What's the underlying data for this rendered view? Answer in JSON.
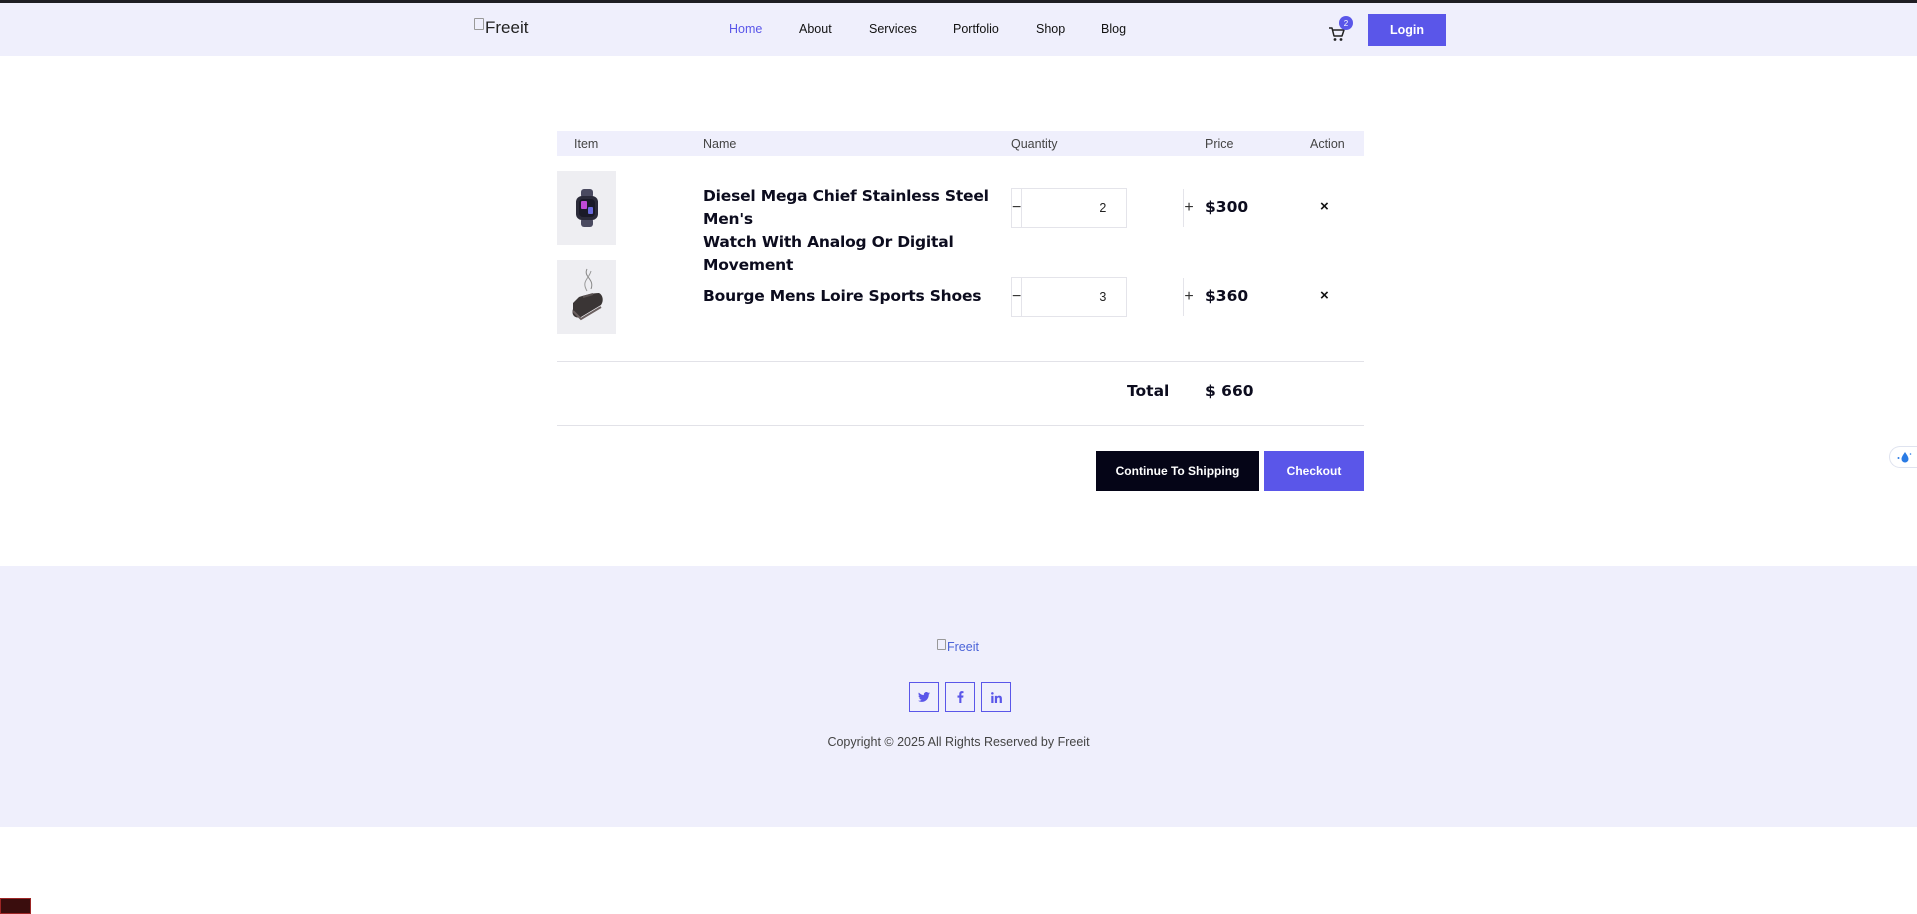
{
  "header": {
    "logo_alt": "Freeit",
    "nav": [
      "Home",
      "About",
      "Services",
      "Portfolio",
      "Shop",
      "Blog"
    ],
    "active_nav": "Home",
    "cart_icon": "cart-icon",
    "cart_count": "2",
    "login_label": "Login"
  },
  "cart": {
    "columns": {
      "item": "Item",
      "name": "Name",
      "quantity": "Quantity",
      "price": "Price",
      "action": "Action"
    },
    "items": [
      {
        "name_line1": "Diesel Mega Chief Stainless Steel Men's",
        "name_line2": "Watch With Analog Or Digital Movement",
        "quantity": "2",
        "price": "$300",
        "image_icon": "smartwatch-image"
      },
      {
        "name_line1": "Bourge Mens Loire Sports Shoes",
        "name_line2": "",
        "quantity": "3",
        "price": "$360",
        "image_icon": "shoe-image"
      }
    ],
    "remove_symbol": "×",
    "minus_symbol": "−",
    "plus_symbol": "+",
    "total_label": "Total",
    "total_value": "$ 660",
    "continue_label": "Continue To Shipping",
    "checkout_label": "Checkout"
  },
  "footer": {
    "logo_alt": "Freeit",
    "socials": [
      "twitter-icon",
      "facebook-icon",
      "linkedin-icon"
    ],
    "copyright": "Copyright © 2025 All Rights Reserved by Freeit"
  },
  "colors": {
    "accent": "#5a56e9",
    "header_bg": "#efeffc",
    "dark_button": "#050517"
  }
}
